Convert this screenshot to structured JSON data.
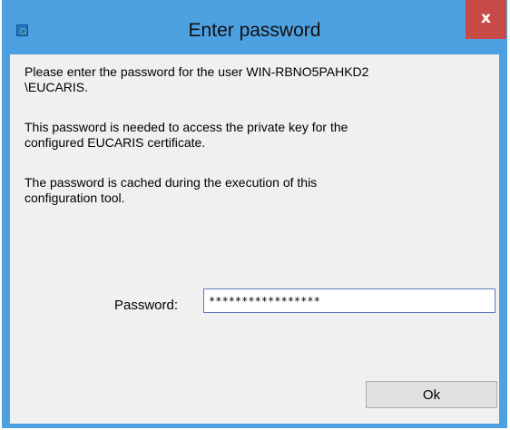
{
  "window": {
    "title": "Enter password",
    "close_label": "x"
  },
  "messages": {
    "line1": "Please enter the password for the user WIN-RBNO5PAHKD2\n\\EUCARIS.",
    "line2": "This password is needed to access the private key for the\nconfigured EUCARIS certificate.",
    "line3": "The password is cached during the execution of this\nconfiguration tool."
  },
  "form": {
    "password_label": "Password:",
    "password_value": "*****************"
  },
  "buttons": {
    "ok_label": "Ok"
  },
  "colors": {
    "frame": "#4ea1e0",
    "close_button": "#c74a47",
    "dialog_body": "#f0f0f0"
  }
}
